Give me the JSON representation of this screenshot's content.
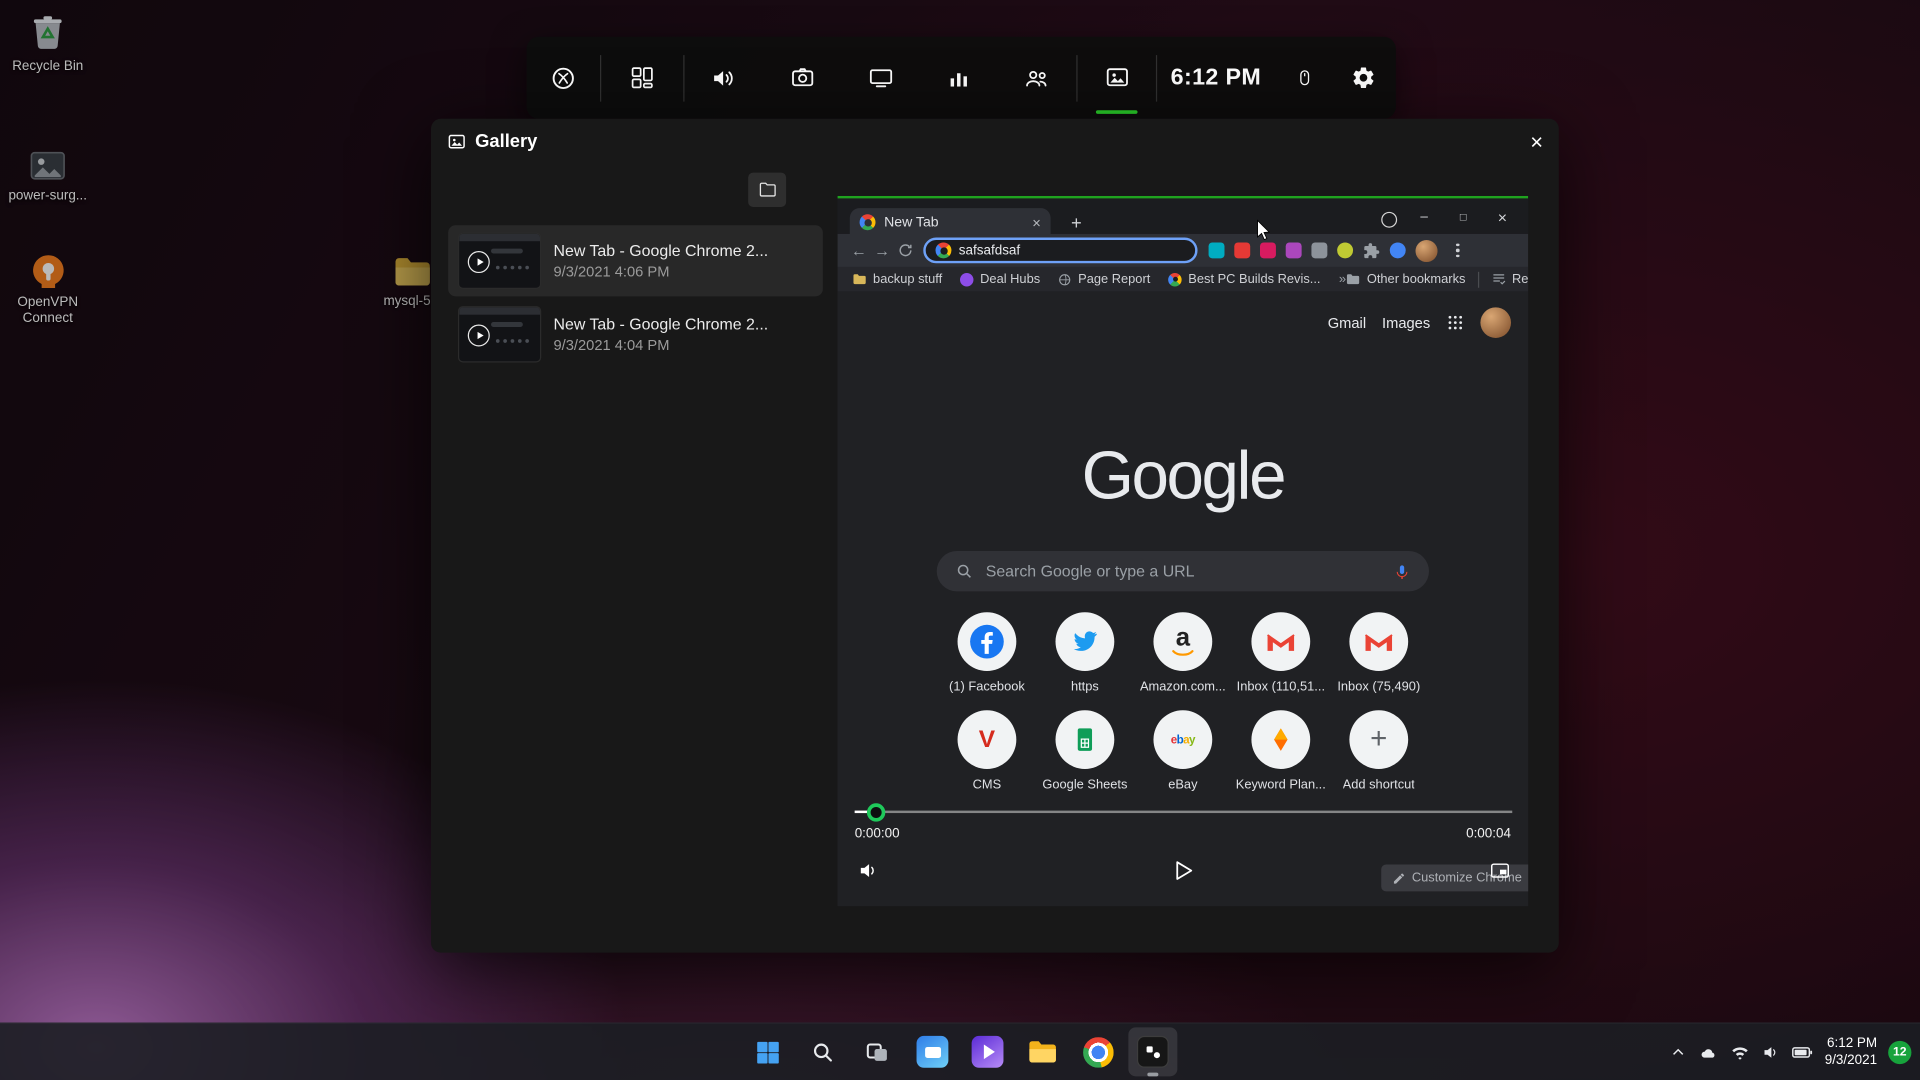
{
  "glyphs": {
    "close": "×",
    "minimize": "–",
    "maximize": "□",
    "plus": "+",
    "back": "←",
    "forward": "→",
    "overflow": "»"
  },
  "icon_glyphs": {
    "amazon": "a",
    "cms": "V",
    "ebay": [
      "e",
      "b",
      "a",
      "y"
    ]
  },
  "colors": {
    "xbox_green": "#2bd42b",
    "focus_blue": "#6ea1f7",
    "badge_green": "#17a33c"
  },
  "desktop": {
    "icons": [
      {
        "label": "Recycle Bin"
      },
      {
        "label": "power-surg..."
      },
      {
        "label": "OpenVPN Connect"
      },
      {
        "label": "mysql-5..."
      }
    ]
  },
  "gamebar_toolbar": {
    "clock": "6:12 PM"
  },
  "gallery": {
    "title": "Gallery",
    "items": [
      {
        "title": "New Tab - Google Chrome 2...",
        "date": "9/3/2021 4:06 PM"
      },
      {
        "title": "New Tab - Google Chrome 2...",
        "date": "9/3/2021 4:04 PM"
      }
    ],
    "player": {
      "elapsed": "0:00:00",
      "duration": "0:00:04"
    }
  },
  "chrome": {
    "tab_title": "New Tab",
    "omnibox_value": "safsafdsaf",
    "bookmarks_bar": {
      "items": [
        "backup stuff",
        "Deal Hubs",
        "Page Report",
        "Best PC Builds Revis..."
      ],
      "other_bookmarks": "Other bookmarks",
      "reading_list": "Reading list"
    },
    "ntp": {
      "gmail": "Gmail",
      "images": "Images",
      "logo": "Google",
      "search_placeholder": "Search Google or type a URL",
      "shortcuts": [
        {
          "label": "(1) Facebook"
        },
        {
          "label": "https"
        },
        {
          "label": "Amazon.com..."
        },
        {
          "label": "Inbox (110,51..."
        },
        {
          "label": "Inbox (75,490)"
        },
        {
          "label": "CMS"
        },
        {
          "label": "Google Sheets"
        },
        {
          "label": "eBay"
        },
        {
          "label": "Keyword Plan..."
        },
        {
          "label": "Add shortcut"
        }
      ],
      "customize": "Customize Chrome"
    }
  },
  "taskbar": {
    "time": "6:12 PM",
    "date": "9/3/2021",
    "badge": "12"
  }
}
